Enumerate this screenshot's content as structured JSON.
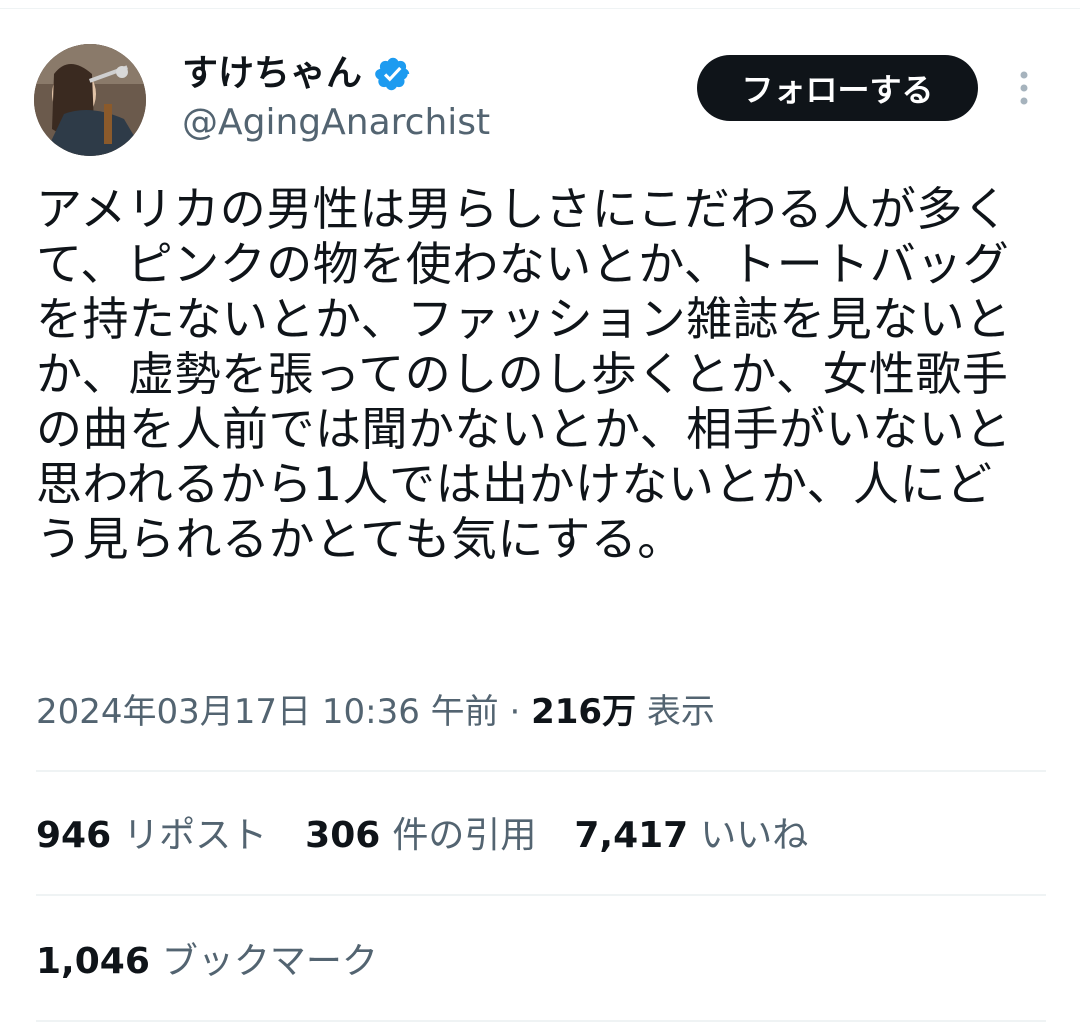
{
  "author": {
    "display_name": "すけちゃん",
    "handle": "@AgingAnarchist",
    "verified": true
  },
  "actions": {
    "follow_label": "フォローする"
  },
  "tweet": {
    "text_lines": [
      "アメリカの男性は男らしさにこだわる人が多く",
      "て、ピンクの物を使わないとか、トートバッグ",
      "を持たないとか、ファッション雑誌を見ないと",
      "か、虚勢を張ってのしのし歩くとか、女性歌手",
      "の曲を人前では聞かないとか、相手がいないと",
      "思われるから1人では出かけないとか、人にど",
      "う見られるかとても気にする。"
    ],
    "timestamp": "2024年03月17日 10:36 午前",
    "separator": "·",
    "views_count": "216万",
    "views_label": "表示"
  },
  "stats": {
    "reposts_count": "946",
    "reposts_label": "リポスト",
    "quotes_count": "306",
    "quotes_label": "件の引用",
    "likes_count": "7,417",
    "likes_label": "いいね",
    "bookmarks_count": "1,046",
    "bookmarks_label": "ブックマーク"
  },
  "colors": {
    "text_primary": "#0f1419",
    "text_secondary": "#536471",
    "verified_blue": "#1d9bf0",
    "button_dark": "#0f1419",
    "divider": "#eff3f4"
  },
  "icons": [
    "verified-badge-icon",
    "more-options-icon"
  ]
}
